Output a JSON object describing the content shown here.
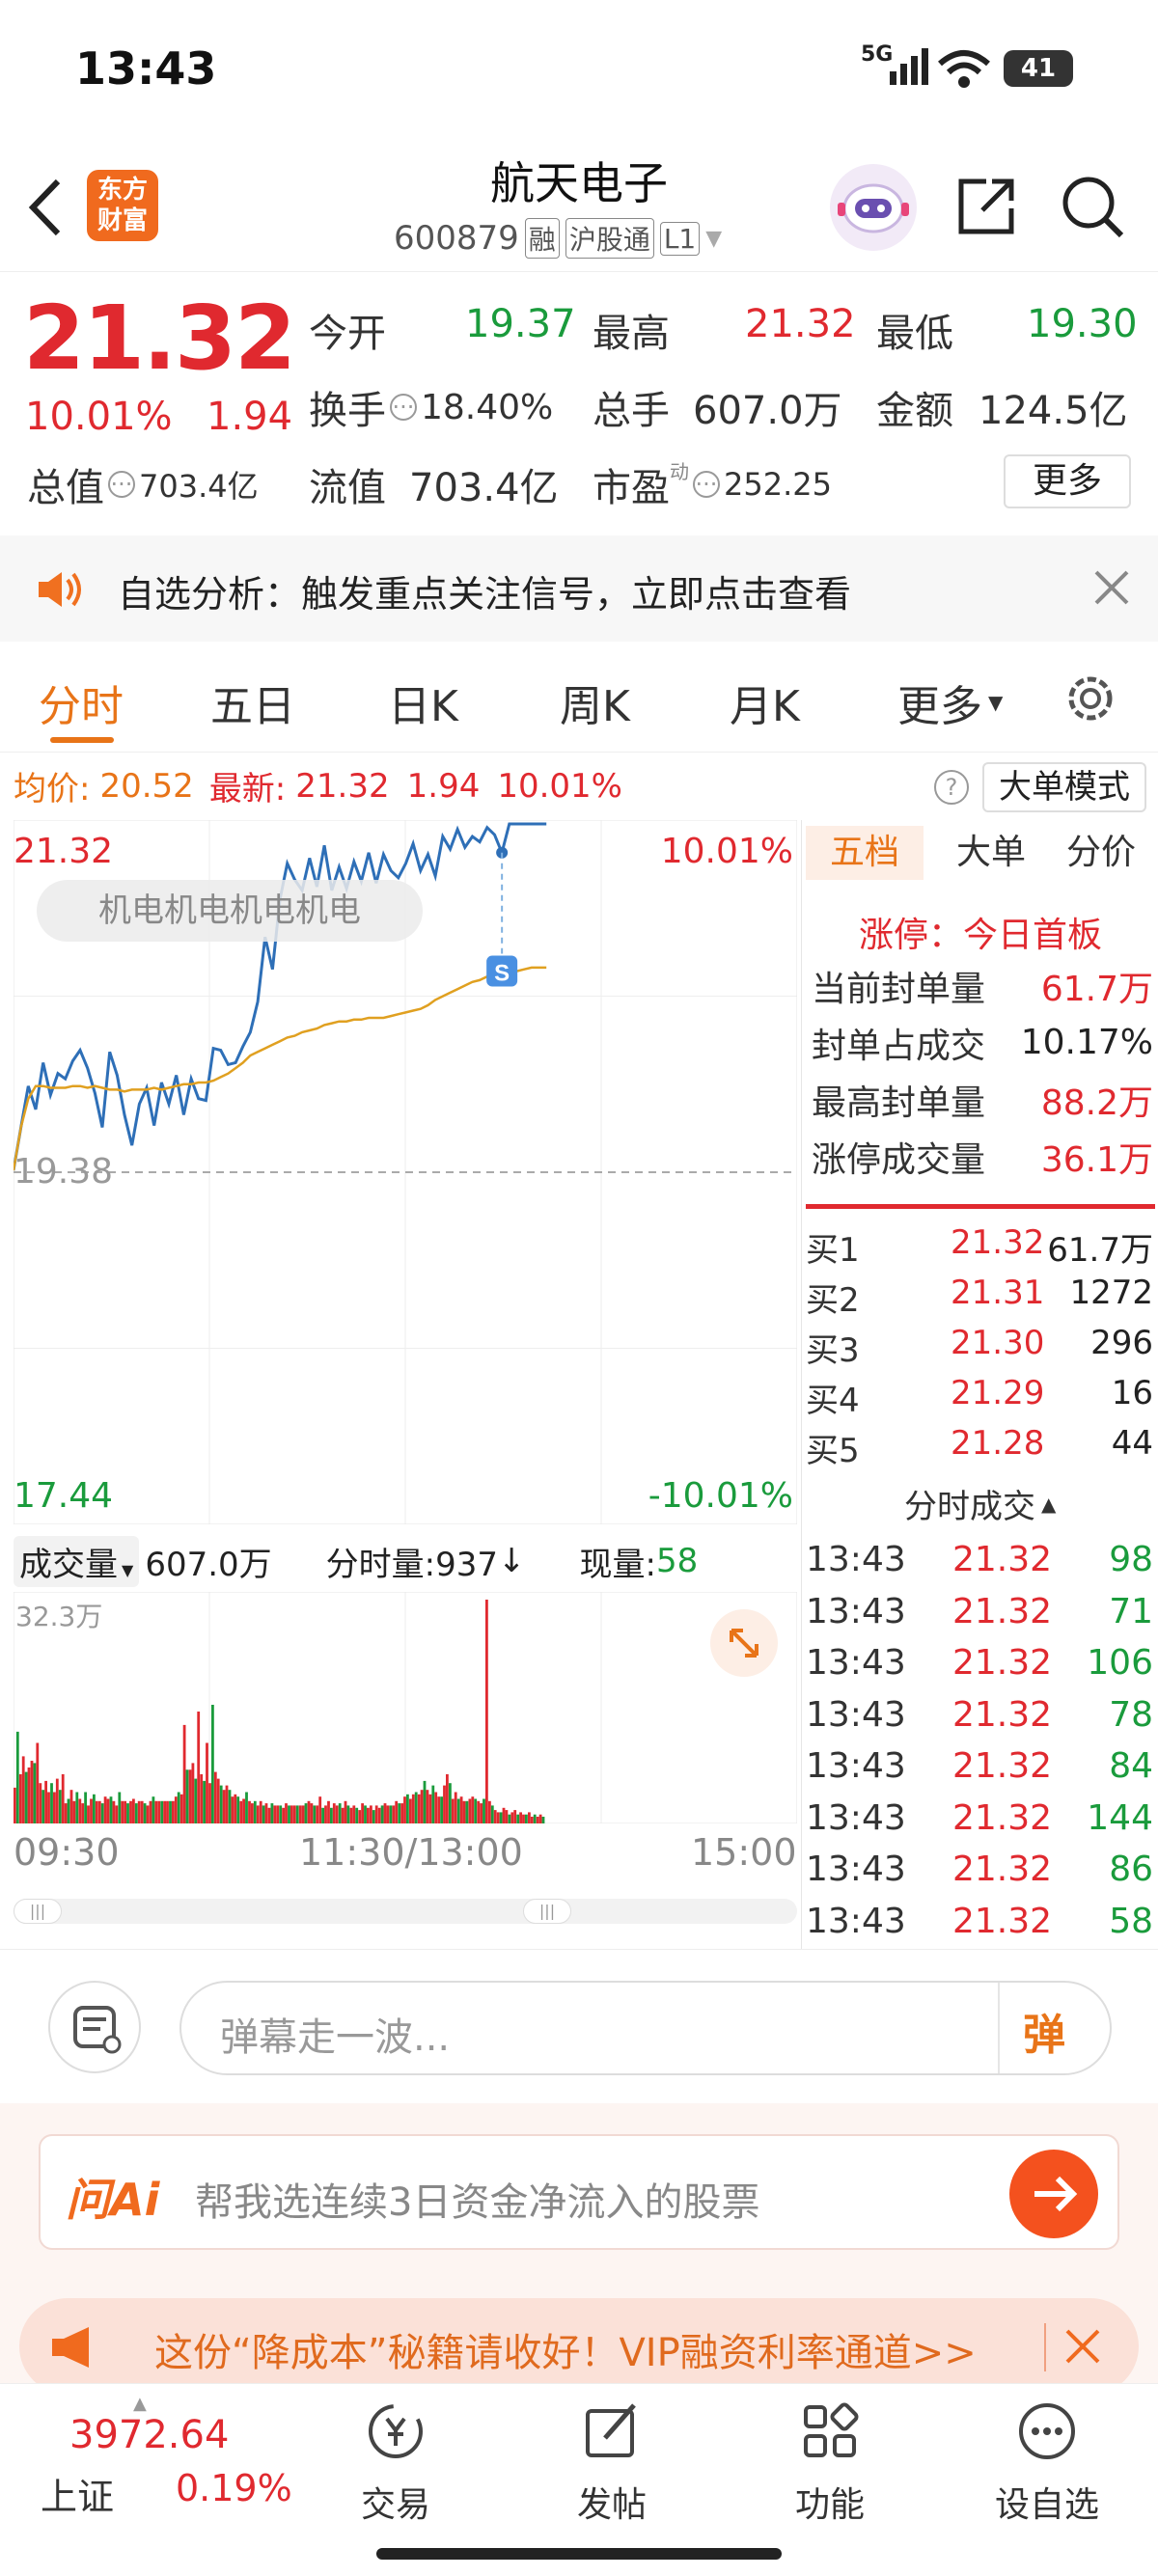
{
  "status_bar": {
    "time": "13:43",
    "network": "5G",
    "battery": "41"
  },
  "header": {
    "title": "航天电子",
    "code": "600879",
    "badge_margin": "融",
    "badge_connect": "沪股通",
    "badge_level": "L1",
    "logo_line1": "东方",
    "logo_line2": "财富"
  },
  "quote": {
    "price": "21.32",
    "change_pct": "10.01%",
    "change": "1.94",
    "open_label": "今开",
    "open": "19.37",
    "high_label": "最高",
    "high": "21.32",
    "low_label": "最低",
    "low": "19.30",
    "turnover_label": "换手",
    "turnover": "18.40%",
    "volume_label": "总手",
    "volume": "607.0万",
    "amount_label": "金额",
    "amount": "124.5亿",
    "mktcap_label": "总值",
    "mktcap": "703.4亿",
    "float_label": "流值",
    "float_cap": "703.4亿",
    "pe_label": "市盈",
    "pe_sup": "动",
    "pe": "252.25",
    "more_label": "更多"
  },
  "notice": {
    "text": "自选分析：触发重点关注信号，立即点击查看"
  },
  "tabs": [
    {
      "label": "分时",
      "active": true
    },
    {
      "label": "五日",
      "active": false
    },
    {
      "label": "日K",
      "active": false
    },
    {
      "label": "周K",
      "active": false
    },
    {
      "label": "月K",
      "active": false
    },
    {
      "label": "更多",
      "active": false
    }
  ],
  "chart_header": {
    "avg_label": "均价:",
    "avg": "20.52",
    "latest_label": "最新:",
    "latest": "21.32",
    "latest_change": "1.94",
    "latest_pct": "10.01%",
    "help": "?",
    "mode_button": "大单模式"
  },
  "chart_data": {
    "type": "line",
    "title": "",
    "xlabel": "",
    "ylabel": "",
    "ylim": [
      17.44,
      21.32
    ],
    "ref_price": "19.38",
    "y_top_label": "21.32",
    "y_bottom_label": "17.44",
    "pct_top_label": "10.01%",
    "pct_bottom_label": "-10.01%",
    "sector_watermark": "机电机电机电机电",
    "marker": "S",
    "x_ticks": [
      "09:30",
      "11:30/13:00",
      "15:00"
    ],
    "series": [
      {
        "name": "",
        "color": "#2e6fb7",
        "values": [
          19.39,
          19.63,
          19.86,
          19.73,
          19.99,
          19.81,
          19.93,
          19.9,
          20.0,
          20.06,
          19.96,
          19.82,
          19.63,
          20.05,
          19.92,
          19.7,
          19.53,
          19.76,
          19.85,
          19.64,
          19.88,
          19.76,
          19.92,
          19.7,
          19.9,
          19.79,
          19.78,
          20.07,
          20.06,
          19.98,
          19.99,
          20.08,
          20.16,
          20.33,
          20.69,
          20.51,
          20.9,
          21.1,
          21.01,
          20.95,
          21.13,
          20.97,
          21.2,
          20.95,
          21.08,
          20.96,
          21.11,
          21.0,
          21.16,
          20.99,
          21.15,
          21.06,
          21.02,
          21.1,
          21.21,
          21.06,
          21.15,
          21.03,
          21.25,
          21.18,
          21.29,
          21.19,
          21.25,
          21.22,
          21.3,
          21.26,
          21.16,
          21.32,
          21.32,
          21.32,
          21.32,
          21.32,
          21.32
        ]
      },
      {
        "name": "",
        "color": "#e0a020",
        "values": [
          19.39,
          19.63,
          19.79,
          19.86,
          19.86,
          19.85,
          19.85,
          19.85,
          19.86,
          19.86,
          19.85,
          19.86,
          19.85,
          19.84,
          19.84,
          19.83,
          19.84,
          19.84,
          19.84,
          19.85,
          19.84,
          19.85,
          19.86,
          19.87,
          19.87,
          19.88,
          19.88,
          19.89,
          19.91,
          19.93,
          19.96,
          19.99,
          20.03,
          20.05,
          20.07,
          20.09,
          20.11,
          20.13,
          20.14,
          20.16,
          20.17,
          20.18,
          20.2,
          20.21,
          20.22,
          20.22,
          20.23,
          20.23,
          20.24,
          20.24,
          20.24,
          20.25,
          20.26,
          20.27,
          20.28,
          20.29,
          20.31,
          20.34,
          20.36,
          20.38,
          20.4,
          20.42,
          20.44,
          20.45,
          20.47,
          20.48,
          20.49,
          20.5,
          20.5,
          20.51,
          20.52,
          20.52,
          20.52
        ]
      }
    ]
  },
  "volume_chart": {
    "label": "成交量",
    "total": "607.0万",
    "tick_label": "分时量:937",
    "arrow": "↓",
    "now_label": "现量:",
    "now": "58",
    "max_label": "32.3万",
    "bars": [
      0.16,
      0.41,
      0.22,
      0.3,
      0.23,
      0.25,
      0.28,
      0.27,
      0.36,
      0.18,
      0.15,
      0.19,
      0.14,
      0.18,
      0.14,
      0.2,
      0.15,
      0.22,
      0.09,
      0.11,
      0.15,
      0.1,
      0.14,
      0.11,
      0.09,
      0.14,
      0.08,
      0.11,
      0.13,
      0.1,
      0.1,
      0.09,
      0.12,
      0.11,
      0.12,
      0.1,
      0.08,
      0.14,
      0.1,
      0.1,
      0.09,
      0.1,
      0.11,
      0.09,
      0.1,
      0.1,
      0.09,
      0.08,
      0.1,
      0.12,
      0.1,
      0.1,
      0.1,
      0.1,
      0.1,
      0.1,
      0.1,
      0.12,
      0.14,
      0.13,
      0.44,
      0.24,
      0.24,
      0.27,
      0.2,
      0.5,
      0.22,
      0.19,
      0.36,
      0.18,
      0.53,
      0.23,
      0.2,
      0.17,
      0.15,
      0.17,
      0.15,
      0.12,
      0.13,
      0.12,
      0.1,
      0.11,
      0.14,
      0.1,
      0.09,
      0.1,
      0.08,
      0.1,
      0.08,
      0.09,
      0.07,
      0.09,
      0.08,
      0.08,
      0.08,
      0.07,
      0.09,
      0.08,
      0.08,
      0.08,
      0.08,
      0.08,
      0.08,
      0.09,
      0.1,
      0.09,
      0.08,
      0.08,
      0.12,
      0.07,
      0.08,
      0.1,
      0.07,
      0.09,
      0.08,
      0.09,
      0.07,
      0.1,
      0.08,
      0.07,
      0.08,
      0.07,
      0.06,
      0.09,
      0.08,
      0.07,
      0.08,
      0.06,
      0.08,
      0.07,
      0.08,
      0.09,
      0.08,
      0.08,
      0.08,
      0.1,
      0.09,
      0.09,
      0.12,
      0.13,
      0.11,
      0.13,
      0.14,
      0.13,
      0.15,
      0.19,
      0.15,
      0.13,
      0.17,
      0.14,
      0.12,
      0.12,
      0.17,
      0.22,
      0.18,
      0.11,
      0.14,
      0.11,
      0.12,
      0.1,
      0.1,
      0.11,
      0.12,
      0.11,
      0.1,
      0.09,
      0.11,
      1.0,
      0.1,
      0.08,
      0.06,
      0.05,
      0.05,
      0.07,
      0.06,
      0.04,
      0.05,
      0.06,
      0.04,
      0.05,
      0.04,
      0.04,
      0.05,
      0.03,
      0.04,
      0.03,
      0.04,
      0.03
    ]
  },
  "order_panel": {
    "tabs": [
      "五档",
      "大单",
      "分价"
    ],
    "limit_title": "涨停：今日首板",
    "stats": [
      {
        "label": "当前封单量",
        "value": "61.7万"
      },
      {
        "label": "封单占成交",
        "value": "10.17%"
      },
      {
        "label": "最高封单量",
        "value": "88.2万"
      },
      {
        "label": "涨停成交量",
        "value": "36.1万"
      }
    ],
    "bids": [
      {
        "label": "买1",
        "price": "21.32",
        "vol": "61.7万"
      },
      {
        "label": "买2",
        "price": "21.31",
        "vol": "1272"
      },
      {
        "label": "买3",
        "price": "21.30",
        "vol": "296"
      },
      {
        "label": "买4",
        "price": "21.29",
        "vol": "16"
      },
      {
        "label": "买5",
        "price": "21.28",
        "vol": "44"
      }
    ],
    "ticks_title": "分时成交",
    "ticks": [
      {
        "time": "13:43",
        "price": "21.32",
        "vol": "98"
      },
      {
        "time": "13:43",
        "price": "21.32",
        "vol": "71"
      },
      {
        "time": "13:43",
        "price": "21.32",
        "vol": "106"
      },
      {
        "time": "13:43",
        "price": "21.32",
        "vol": "78"
      },
      {
        "time": "13:43",
        "price": "21.32",
        "vol": "84"
      },
      {
        "time": "13:43",
        "price": "21.32",
        "vol": "144"
      },
      {
        "time": "13:43",
        "price": "21.32",
        "vol": "86"
      },
      {
        "time": "13:43",
        "price": "21.32",
        "vol": "58"
      }
    ]
  },
  "danmaku": {
    "placeholder": "弹幕走一波...",
    "send_label": "弹"
  },
  "ai_bar": {
    "logo": "问Ai",
    "prompt": "帮我选连续3日资金净流入的股票"
  },
  "promo": {
    "text": "这份“降成本”秘籍请收好！VIP融资利率通道>>"
  },
  "bottom_nav": {
    "index_value": "3972.64",
    "index_name": "上证",
    "index_pct": "0.19%",
    "items": [
      {
        "label": "交易",
        "icon": "yen-exchange-icon"
      },
      {
        "label": "发帖",
        "icon": "edit-post-icon"
      },
      {
        "label": "功能",
        "icon": "grid-apps-icon"
      },
      {
        "label": "设自选",
        "icon": "more-dots-icon"
      }
    ]
  }
}
